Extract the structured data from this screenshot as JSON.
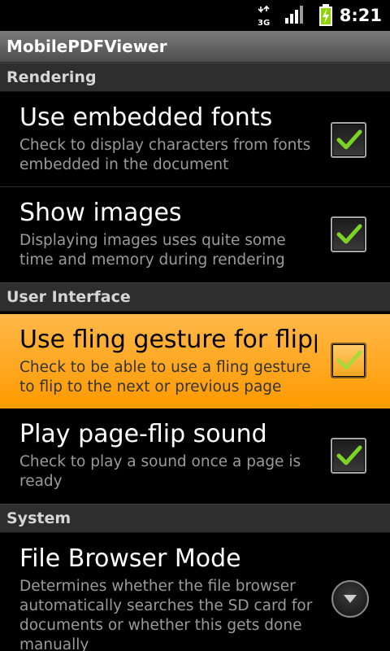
{
  "status_bar": {
    "time": "8:21",
    "network_label": "3G",
    "icons": [
      "3g-data-icon",
      "signal-strength-icon",
      "battery-charging-icon"
    ]
  },
  "app_title": "MobilePDFViewer",
  "categories": {
    "rendering": "Rendering",
    "user_interface": "User Interface",
    "system": "System"
  },
  "preferences": [
    {
      "title": "Use embedded fonts",
      "summary": "Check to display characters from fonts embedded in the document",
      "checked": true
    },
    {
      "title": "Show images",
      "summary": "Displaying images uses quite some time and memory during rendering",
      "checked": true
    },
    {
      "title": "Use fling gesture for flipping",
      "summary": "Check to be able to use a fling gesture to flip to the next or previous page",
      "checked": true,
      "highlighted": true
    },
    {
      "title": "Play page-flip sound",
      "summary": "Check to play a sound once a page is ready",
      "checked": true
    },
    {
      "title": "File Browser Mode",
      "summary": "Determines whether the file browser automatically searches the SD card for documents or whether this gets done manually",
      "control": "dropdown"
    }
  ],
  "colors": {
    "highlight": "#ffa826",
    "checkmark": "#7bd424",
    "category_bg": "#2e2e2e"
  }
}
